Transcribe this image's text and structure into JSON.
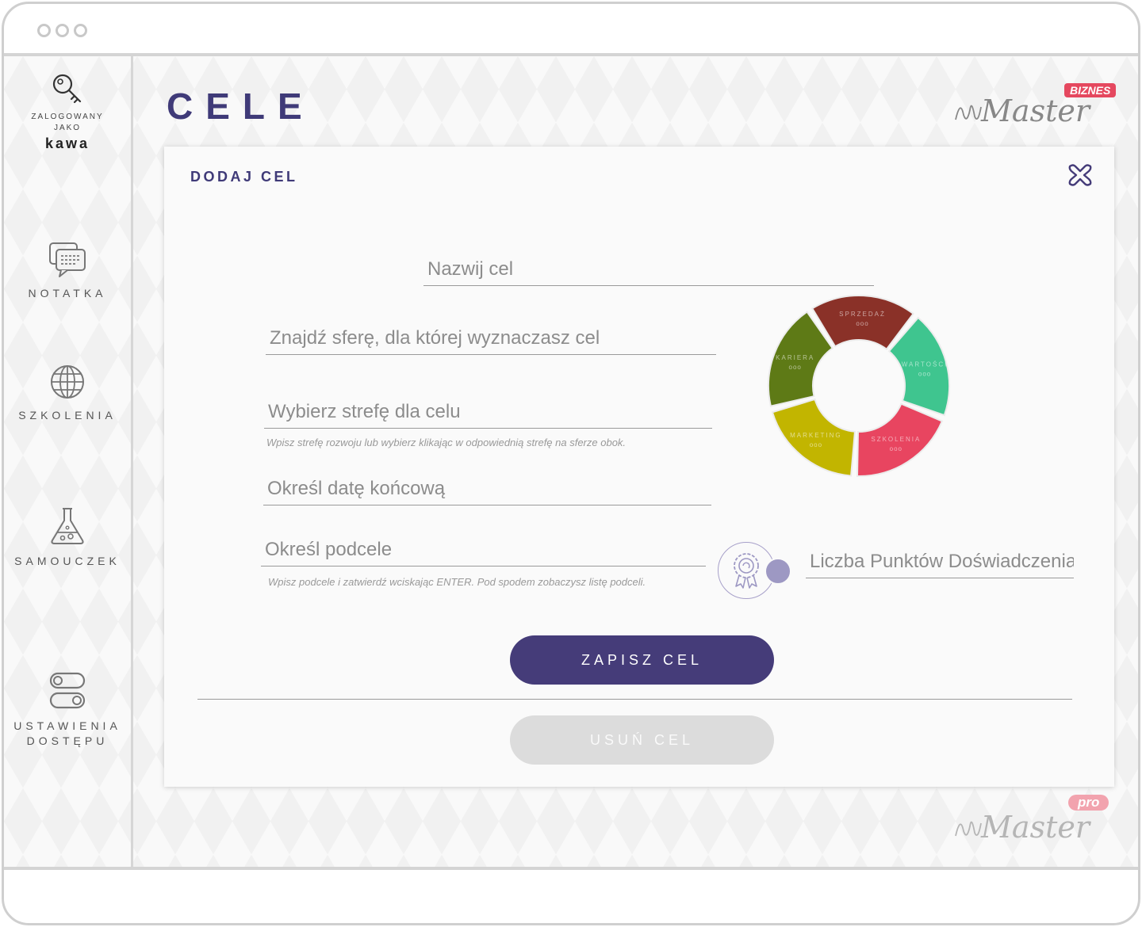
{
  "user": {
    "caption": "ZALOGOWANY JAKO",
    "name": "kawa"
  },
  "sidebar": {
    "items": [
      {
        "label": "NOTATKA",
        "icon": "chat-icon"
      },
      {
        "label": "SZKOLENIA",
        "icon": "globe-icon"
      },
      {
        "label": "SAMOUCZEK",
        "icon": "flask-icon"
      },
      {
        "label": "USTAWIENIA DOSTĘPU",
        "icon": "toggles-icon"
      }
    ]
  },
  "header": {
    "title": "CELE",
    "brand_top": {
      "word": "Master",
      "tag": "BIZNES",
      "tag_color": "#e5485f"
    },
    "brand_bottom": {
      "word": "Master",
      "tag": "pro",
      "tag_color": "#f2a3ae"
    }
  },
  "modal": {
    "title": "DODAJ CEL",
    "fields": {
      "goal_name": {
        "value": "",
        "placeholder": "Nazwij cel"
      },
      "sphere": {
        "value": "",
        "placeholder": "Znajdź sferę, dla której wyznaczasz cel"
      },
      "zone": {
        "value": "",
        "placeholder": "Wybierz strefę dla celu"
      },
      "end_date": {
        "value": "",
        "placeholder": "Określ datę końcową"
      },
      "subgoals": {
        "value": "",
        "placeholder": "Określ podcele"
      },
      "xp_points": {
        "value": "",
        "placeholder": "Liczba Punktów Doświadczenia"
      }
    },
    "hints": {
      "zone": "Wpisz strefę rozwoju lub wybierz klikając w odpowiednią strefę na sferze obok.",
      "subgoals": "Wpisz podcele i zatwierdź wciskając ENTER. Pod spodem zobaczysz listę podceli."
    },
    "buttons": {
      "save": "ZAPISZ CEL",
      "delete": "USUŃ CEL"
    }
  },
  "sphere_wheel": {
    "segments": [
      {
        "label": "SPRZEDAŻ",
        "dots": "ooo",
        "color": "#8a3128"
      },
      {
        "label": "WARTOŚCI",
        "dots": "ooo",
        "color": "#3fc58f"
      },
      {
        "label": "SZKOLENIA",
        "dots": "ooo",
        "color": "#e84560"
      },
      {
        "label": "MARKETING",
        "dots": "ooo",
        "color": "#c2b500"
      },
      {
        "label": "KARIERA",
        "dots": "ooo",
        "color": "#5e7a16"
      }
    ]
  },
  "colors": {
    "accent": "#3f3a78",
    "button_primary": "#453c79",
    "button_disabled": "#dcdcdc"
  }
}
